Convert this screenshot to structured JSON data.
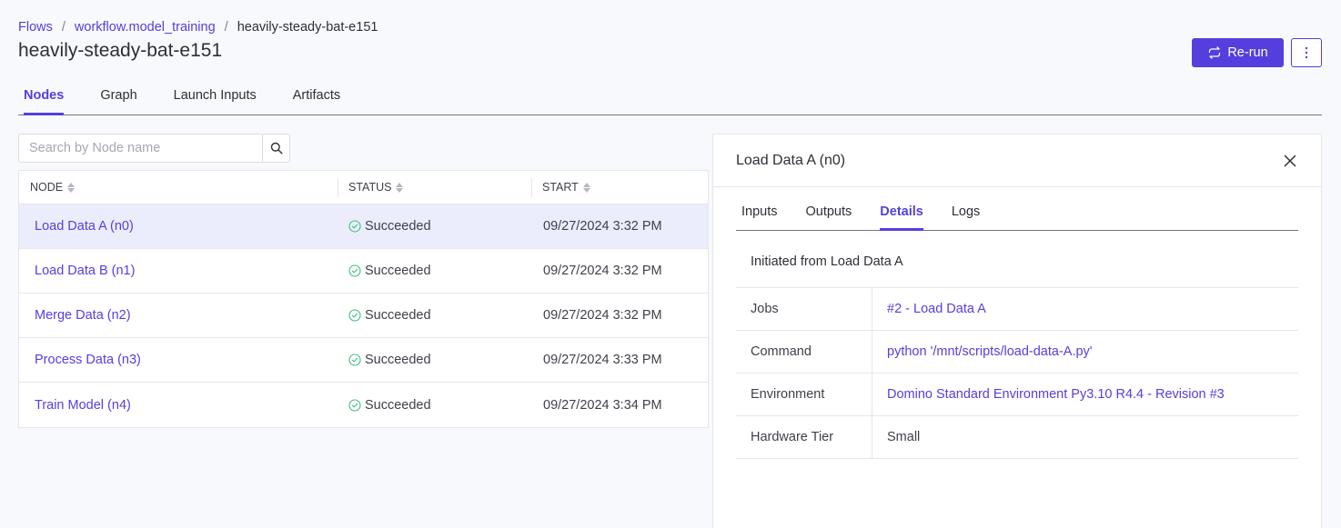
{
  "breadcrumb": {
    "items": [
      {
        "label": "Flows",
        "link": true
      },
      {
        "label": "workflow.model_training",
        "link": true
      },
      {
        "label": "heavily-steady-bat-e151",
        "link": false
      }
    ],
    "separator": "/"
  },
  "page": {
    "title": "heavily-steady-bat-e151"
  },
  "actions": {
    "rerun_label": "Re-run",
    "rerun_icon": "refresh-icon",
    "more_icon": "more-vertical-icon"
  },
  "main_tabs": [
    {
      "label": "Nodes",
      "active": true
    },
    {
      "label": "Graph",
      "active": false
    },
    {
      "label": "Launch Inputs",
      "active": false
    },
    {
      "label": "Artifacts",
      "active": false
    }
  ],
  "search": {
    "placeholder": "Search by Node name",
    "value": "",
    "icon": "search-icon"
  },
  "nodes_table": {
    "columns": [
      "NODE",
      "STATUS",
      "START"
    ],
    "rows": [
      {
        "node": "Load Data A (n0)",
        "status": "Succeeded",
        "start": "09/27/2024 3:32 PM",
        "selected": true
      },
      {
        "node": "Load Data B (n1)",
        "status": "Succeeded",
        "start": "09/27/2024 3:32 PM",
        "selected": false
      },
      {
        "node": "Merge Data (n2)",
        "status": "Succeeded",
        "start": "09/27/2024 3:32 PM",
        "selected": false
      },
      {
        "node": "Process Data (n3)",
        "status": "Succeeded",
        "start": "09/27/2024 3:33 PM",
        "selected": false
      },
      {
        "node": "Train Model (n4)",
        "status": "Succeeded",
        "start": "09/27/2024 3:34 PM",
        "selected": false
      }
    ]
  },
  "detail_panel": {
    "title": "Load Data A (n0)",
    "tabs": [
      {
        "label": "Inputs",
        "active": false
      },
      {
        "label": "Outputs",
        "active": false
      },
      {
        "label": "Details",
        "active": true
      },
      {
        "label": "Logs",
        "active": false
      }
    ],
    "initiated_text": "Initiated from Load Data A",
    "details": [
      {
        "key": "Jobs",
        "value": "#2 - Load Data A",
        "link": true
      },
      {
        "key": "Command",
        "value": "python '/mnt/scripts/load-data-A.py'",
        "link": true
      },
      {
        "key": "Environment",
        "value": "Domino Standard Environment Py3.10 R4.4 - Revision #3",
        "link": true
      },
      {
        "key": "Hardware Tier",
        "value": "Small",
        "link": false
      }
    ]
  },
  "colors": {
    "accent": "#543fde",
    "success": "#3fc07a",
    "selected_row": "#ebedfc",
    "background": "#f8f9fc"
  }
}
